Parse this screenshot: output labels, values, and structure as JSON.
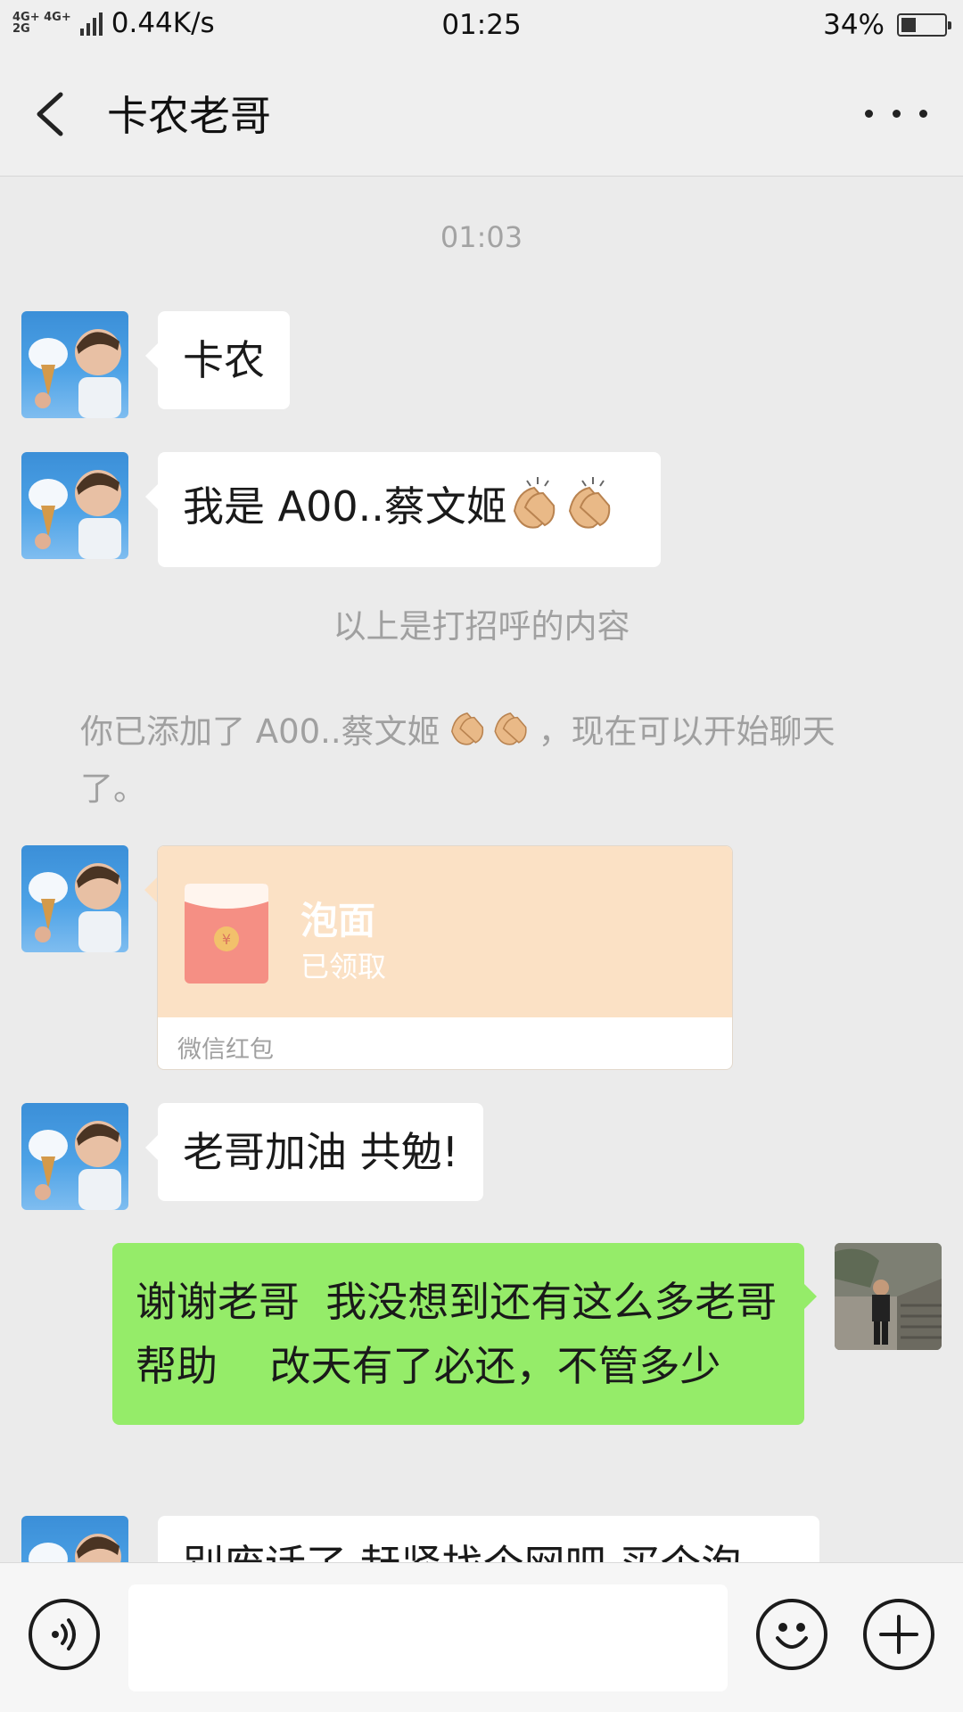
{
  "status_bar": {
    "network_types": [
      "4G+ 4G+",
      "2G"
    ],
    "speed": "0.44K/s",
    "time": "01:25",
    "battery_percent": "34%",
    "battery_level": 0.34
  },
  "header": {
    "title": "卡农老哥"
  },
  "chat": {
    "timestamp": "01:03",
    "messages": [
      {
        "text": "卡农"
      },
      {
        "text": "我是 A00..蔡文姬"
      },
      {
        "text": "老哥加油 共勉!"
      },
      {
        "text": "谢谢老哥  我没想到还有这么多老哥帮助    改天有了必还，不管多少"
      },
      {
        "text": "别废话了 赶紧找个网吧 买个泡"
      }
    ],
    "greeting_note": "以上是打招呼的内容",
    "added_note_prefix": "你已添加了 A00..蔡文姬",
    "added_note_suffix": "，现在可以开始聊天了。",
    "red_packet": {
      "title": "泡面",
      "status": "已领取",
      "footer": "微信红包"
    }
  },
  "input_bar": {
    "value": ""
  },
  "colors": {
    "sent_bubble": "#95ec69",
    "received_bubble": "#ffffff",
    "red_packet": "#fbe1c5",
    "background": "#ebebeb"
  },
  "icons": [
    "back-icon",
    "more-icon",
    "voice-icon",
    "emoji-icon",
    "plus-icon",
    "clap-emoji",
    "red-envelope-icon",
    "battery-icon",
    "signal-icon"
  ]
}
